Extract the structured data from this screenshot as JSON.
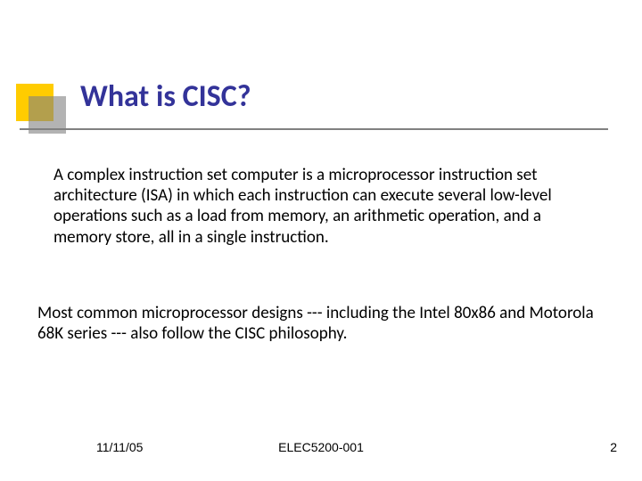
{
  "title": "What is CISC?",
  "paragraphs": {
    "p1": "A complex instruction set computer is a microprocessor instruction set architecture (ISA) in which each instruction can execute several low-level operations such as a load from memory, an arithmetic operation, and a memory store, all in a single  instruction.",
    "p2": "Most common microprocessor designs --- including the Intel 80x86 and Motorola 68K series --- also follow the CISC philosophy."
  },
  "footer": {
    "date": "11/11/05",
    "course": "ELEC5200-001",
    "page": "2"
  },
  "accent_colors": {
    "yellow": "#ffcc00",
    "gray": "#808080",
    "title_blue": "#333399"
  }
}
